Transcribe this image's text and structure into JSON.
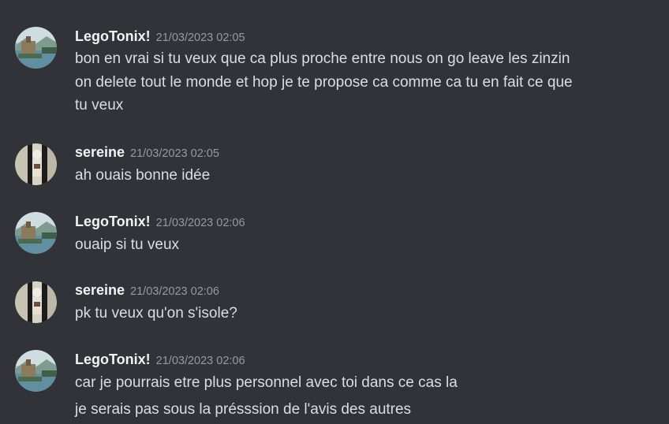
{
  "messages": [
    {
      "author": "LegoTonix!",
      "avatar_icon": "lake-castle-avatar-icon",
      "timestamp": "21/03/2023 02:05",
      "lines": [
        "bon en vrai si tu veux que ca plus proche entre nous on go leave les zinzin",
        "on delete tout le monde et hop je te propose ca comme ca tu en fait ce que",
        "tu veux"
      ]
    },
    {
      "author": "sereine",
      "avatar_icon": "figure-portrait-avatar-icon",
      "timestamp": "21/03/2023 02:05",
      "lines": [
        "ah ouais bonne idée"
      ]
    },
    {
      "author": "LegoTonix!",
      "avatar_icon": "lake-castle-avatar-icon",
      "timestamp": "21/03/2023 02:06",
      "lines": [
        "ouaip si tu veux"
      ]
    },
    {
      "author": "sereine",
      "avatar_icon": "figure-portrait-avatar-icon",
      "timestamp": "21/03/2023 02:06",
      "lines": [
        "pk tu veux qu'on s'isole?"
      ]
    },
    {
      "author": "LegoTonix!",
      "avatar_icon": "lake-castle-avatar-icon",
      "timestamp": "21/03/2023 02:06",
      "lines": [
        "car je pourrais etre plus personnel avec toi dans ce cas la",
        "je serais pas sous la présssion de l'avis des autres"
      ]
    }
  ],
  "colors": {
    "background": "#313338",
    "username": "#f2f3f5",
    "timestamp": "#949ba4",
    "message_text": "#dbdee1"
  }
}
